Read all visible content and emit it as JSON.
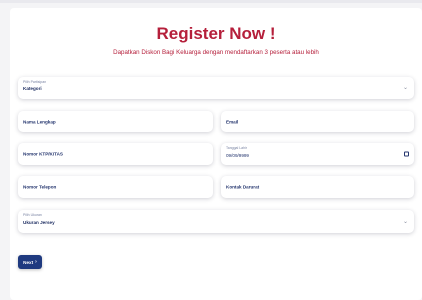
{
  "header": {
    "title": "Register Now !",
    "subtitle": "Dapatkan Diskon Bagi Keluarga dengan mendaftarkan 3 peserta atau lebih"
  },
  "form": {
    "participant": {
      "label": "Pilih Partisipan",
      "value": "Kategori"
    },
    "full_name": {
      "placeholder": "Nama Lengkap"
    },
    "email": {
      "placeholder": "Email"
    },
    "id_number": {
      "placeholder": "Nomor KTP/KITAS"
    },
    "birth_date": {
      "label": "Tanggal Lahir",
      "value": "09/09/9999"
    },
    "phone": {
      "placeholder": "Nomor Telepon"
    },
    "emergency_contact": {
      "placeholder": "Kontak Darurat"
    },
    "jersey_size": {
      "label": "Pilih Ukuran",
      "value": "Ukuran Jersey"
    },
    "next_label": "Next",
    "next_arrow": "›"
  },
  "icons": {
    "dropdown": "chevron-down-icon",
    "calendar": "calendar-icon"
  },
  "colors": {
    "title": "#b51f3b",
    "button": "#1f3a80",
    "field_text": "#24356e"
  }
}
